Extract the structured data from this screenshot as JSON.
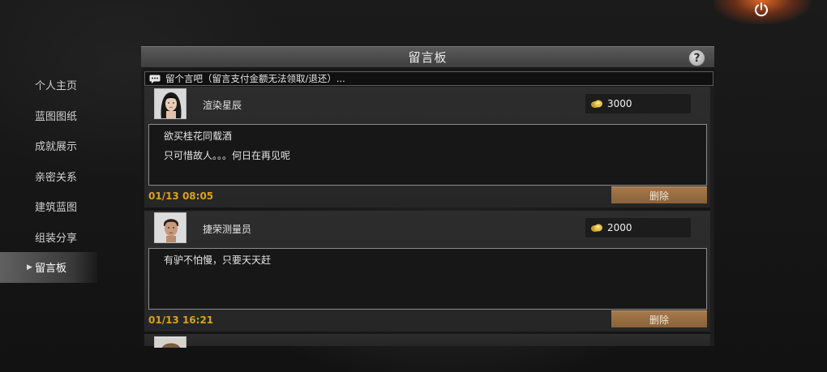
{
  "sidebar": {
    "items": [
      {
        "label": "个人主页",
        "active": false
      },
      {
        "label": "蓝图图纸",
        "active": false
      },
      {
        "label": "成就展示",
        "active": false
      },
      {
        "label": "亲密关系",
        "active": false
      },
      {
        "label": "建筑蓝图",
        "active": false
      },
      {
        "label": "组装分享",
        "active": false
      },
      {
        "label": "留言板",
        "active": true
      }
    ]
  },
  "panel": {
    "title": "留言板",
    "help_icon": "?",
    "compose_prompt": "留个言吧（留言支付金额无法领取/退还）..."
  },
  "messages": [
    {
      "username": "渲染星辰",
      "gold": "3000",
      "lines": [
        "欲买桂花同载酒",
        "只可惜故人。。。何日在再见呢"
      ],
      "time": "01/13 08:05",
      "delete_label": "删除"
    },
    {
      "username": "捷荣测量员",
      "gold": "2000",
      "lines": [
        "有驴不怕慢，只要天天赶"
      ],
      "time": "01/13 16:21",
      "delete_label": "删除"
    }
  ],
  "colors": {
    "accent_gold_text": "#d9a21b",
    "delete_button": "#9a6e42",
    "power_glow": "#ff7a2a"
  },
  "icons": {
    "power": "power-icon",
    "help": "help-icon",
    "chat": "chat-bubble-icon",
    "coin": "gold-coin-icon"
  }
}
